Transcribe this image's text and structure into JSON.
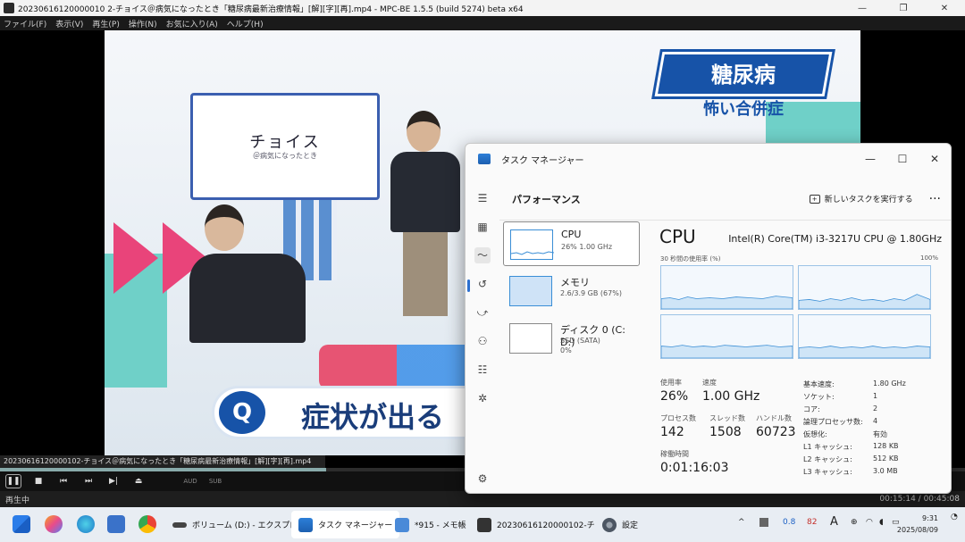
{
  "player": {
    "title": "20230616120000010 2-チョイス＠病気になったとき「糖尿病最新治療情報」[解][字][再].mp4 - MPC-BE 1.5.5 (build 5274) beta x64",
    "menu": [
      "ファイル(F)",
      "表示(V)",
      "再生(P)",
      "操作(N)",
      "お気に入り(A)",
      "ヘルプ(H)"
    ],
    "video": {
      "board_title": "チョイス",
      "board_sub": "＠病気になったとき",
      "badge_text": "糖尿病",
      "badge_sub": "怖い合併症",
      "q_label": "Q",
      "caption": "症状が出る"
    },
    "filename": "20230616120000102-チョイス＠病気になったとき「糖尿病最新治療情報」[解][字][再].mp4",
    "seek_progress": 0.338,
    "controls": {
      "au_label": "AUD",
      "sub_label": "SUB"
    },
    "status_left": "再生中",
    "status_time": "00:15:14 / 00:45:08"
  },
  "taskmgr": {
    "title": "タスク マネージャー",
    "section_title": "パフォーマンス",
    "run_task": "新しいタスクを実行する",
    "more": "···",
    "items": [
      {
        "name": "CPU",
        "sub": "26%  1.00 GHz"
      },
      {
        "name": "メモリ",
        "sub": "2.6/3.9 GB (67%)"
      },
      {
        "name": "ディスク 0 (C: D:)",
        "sub": "SSD (SATA)",
        "sub2": "0%"
      }
    ],
    "detail": {
      "title": "CPU",
      "model": "Intel(R) Core(TM) i3-3217U CPU @ 1.80GHz",
      "graph_label": "30 秒間の使用率 (%)",
      "graph_max": "100%",
      "usage_lbl": "使用率",
      "usage_val": "26%",
      "speed_lbl": "速度",
      "speed_val": "1.00 GHz",
      "proc_lbl": "プロセス数",
      "proc_val": "142",
      "thread_lbl": "スレッド数",
      "thread_val": "1508",
      "handle_lbl": "ハンドル数",
      "handle_val": "60723",
      "uptime_lbl": "稼働時間",
      "uptime_val": "0:01:16:03",
      "specs": [
        {
          "k": "基本速度:",
          "v": "1.80 GHz"
        },
        {
          "k": "ソケット:",
          "v": "1"
        },
        {
          "k": "コア:",
          "v": "2"
        },
        {
          "k": "論理プロセッサ数:",
          "v": "4"
        },
        {
          "k": "仮想化:",
          "v": "有効"
        },
        {
          "k": "L1 キャッシュ:",
          "v": "128 KB"
        },
        {
          "k": "L2 キャッシュ:",
          "v": "512 KB"
        },
        {
          "k": "L3 キャッシュ:",
          "v": "3.0 MB"
        }
      ]
    }
  },
  "taskbar": {
    "apps": [
      {
        "label": "ボリューム (D:) - エクスプロー"
      },
      {
        "label": "タスク マネージャー"
      },
      {
        "label": "*915 - メモ帳"
      },
      {
        "label": "20230616120000102-チ"
      },
      {
        "label": "設定"
      }
    ],
    "tray_nums": [
      "0.8",
      "82"
    ],
    "tray_a": "A",
    "time": "9:31",
    "date": "2025/08/09"
  }
}
